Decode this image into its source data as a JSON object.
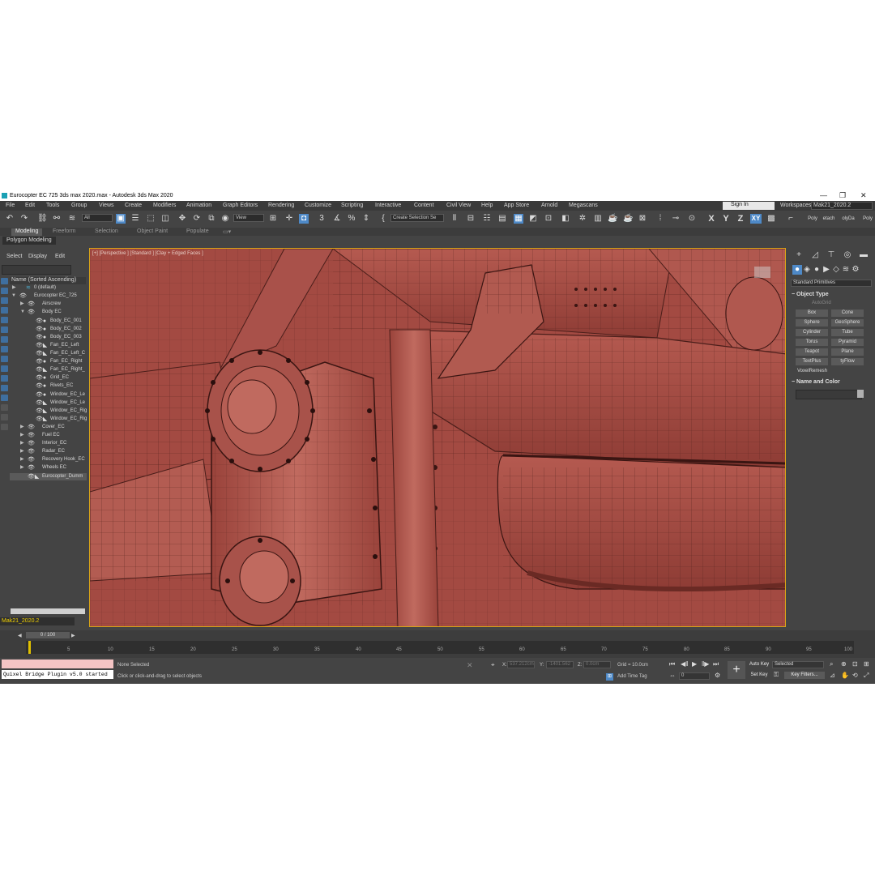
{
  "window": {
    "title": "Eurocopter EC 725 3ds max 2020.max - Autodesk 3ds Max 2020",
    "minimize": "—",
    "restore": "❐",
    "close": "✕"
  },
  "menu": [
    "File",
    "Edit",
    "Tools",
    "Group",
    "Views",
    "Create",
    "Modifiers",
    "Animation",
    "Graph Editors",
    "Rendering",
    "Customize",
    "Scripting",
    "Interactive",
    "Content",
    "Civil View",
    "Help",
    "App Store",
    "Arnold",
    "Megascans"
  ],
  "account": {
    "sign_in": "Sign In",
    "workspaces_label": "Workspaces:",
    "workspace": "Mak21_2020.2"
  },
  "toolbar": {
    "filter": "All",
    "refcoord": "View",
    "selection_set": "Create Selection Se",
    "axis_x": "X",
    "axis_y": "Y",
    "axis_z": "Z",
    "axis_xy": "XY",
    "right_labels": [
      "Poly",
      "etach",
      "olyDa",
      "Poly"
    ]
  },
  "ribbon": {
    "tabs": [
      "Modeling",
      "Freeform",
      "Selection",
      "Object Paint",
      "Populate"
    ],
    "sub": "Polygon Modeling"
  },
  "scene_explorer": {
    "tabs": [
      "Select",
      "Display",
      "Edit"
    ],
    "column": "Name (Sorted Ascending)",
    "rows": [
      {
        "name": "0 (default)",
        "level": 1
      },
      {
        "name": "Eurocopter EC_725",
        "level": 1
      },
      {
        "name": "Airscrew",
        "level": 2
      },
      {
        "name": "Body EC",
        "level": 2
      },
      {
        "name": "Body_EC_001",
        "level": 3
      },
      {
        "name": "Body_EC_002",
        "level": 3
      },
      {
        "name": "Body_EC_003",
        "level": 3
      },
      {
        "name": "Fan_EC_Left",
        "level": 3
      },
      {
        "name": "Fan_EC_Left_C",
        "level": 3
      },
      {
        "name": "Fan_EC_Right",
        "level": 3
      },
      {
        "name": "Fan_EC_Right_",
        "level": 3
      },
      {
        "name": "Grid_EC",
        "level": 3
      },
      {
        "name": "Rivets_EC",
        "level": 3
      },
      {
        "name": "Window_EC_Le",
        "level": 3
      },
      {
        "name": "Window_EC_Le",
        "level": 3
      },
      {
        "name": "Window_EC_Rig",
        "level": 3
      },
      {
        "name": "Window_EC_Rig",
        "level": 3
      },
      {
        "name": "Cover_EC",
        "level": 2
      },
      {
        "name": "Fuel EC",
        "level": 2
      },
      {
        "name": "Interior_EC",
        "level": 2
      },
      {
        "name": "Radar_EC",
        "level": 2
      },
      {
        "name": "Recovery Hook_EC",
        "level": 2
      },
      {
        "name": "Wheels EC",
        "level": 2
      },
      {
        "name": "Eurocopter_Dumm",
        "level": 2
      }
    ],
    "layer": "Mak21_2020.2"
  },
  "viewport": {
    "label": "[+] [Perspective ] [Standard ] [Clay + Edged Faces ]"
  },
  "command_panel": {
    "category": "Standard Primitives",
    "object_type_title": "Object Type",
    "autogrid": "AutoGrid",
    "buttons": [
      "Box",
      "Cone",
      "Sphere",
      "GeoSphere",
      "Cylinder",
      "Tube",
      "Torus",
      "Pyramid",
      "Teapot",
      "Plane",
      "TextPlus",
      "tyFlow"
    ],
    "voxel": "VoxelRemesh",
    "name_color_title": "Name and Color"
  },
  "timeline": {
    "frame": "0 / 100",
    "ticks": [
      "5",
      "10",
      "15",
      "20",
      "25",
      "30",
      "35",
      "40",
      "45",
      "50",
      "55",
      "60",
      "65",
      "70",
      "75",
      "80",
      "85",
      "90",
      "95",
      "100"
    ]
  },
  "status": {
    "maxscript_output": "Quixel Bridge Plugin v5.0 started",
    "none_selected": "None Selected",
    "prompt": "Click or click-and-drag to select objects",
    "x_label": "X:",
    "x_value": "537.212cm",
    "y_label": "Y:",
    "y_value": "-1401.562",
    "z_label": "Z:",
    "z_value": "0.0cm",
    "grid": "Grid = 10.0cm",
    "add_time_tag": "Add Time Tag",
    "auto_key": "Auto Key",
    "set_key": "Set Key",
    "selected": "Selected",
    "key_filters": "Key Filters...",
    "frame_field": "0"
  },
  "colors": {
    "model": "#a34a42",
    "viewport_border": "#d8a418",
    "ui_dark": "#444444",
    "accent": "#4e89c7"
  }
}
